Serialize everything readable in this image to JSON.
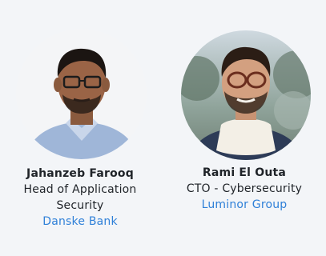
{
  "speakers": [
    {
      "name": "Jahanzeb Farooq",
      "role": "Head of Application Security",
      "org": "Danske Bank"
    },
    {
      "name": "Rami El Outa",
      "role": "CTO - Cybersecurity",
      "org": "Luminor Group"
    }
  ],
  "colors": {
    "background": "#f3f5f8",
    "link": "#2f80d8",
    "text": "#1f2328"
  }
}
